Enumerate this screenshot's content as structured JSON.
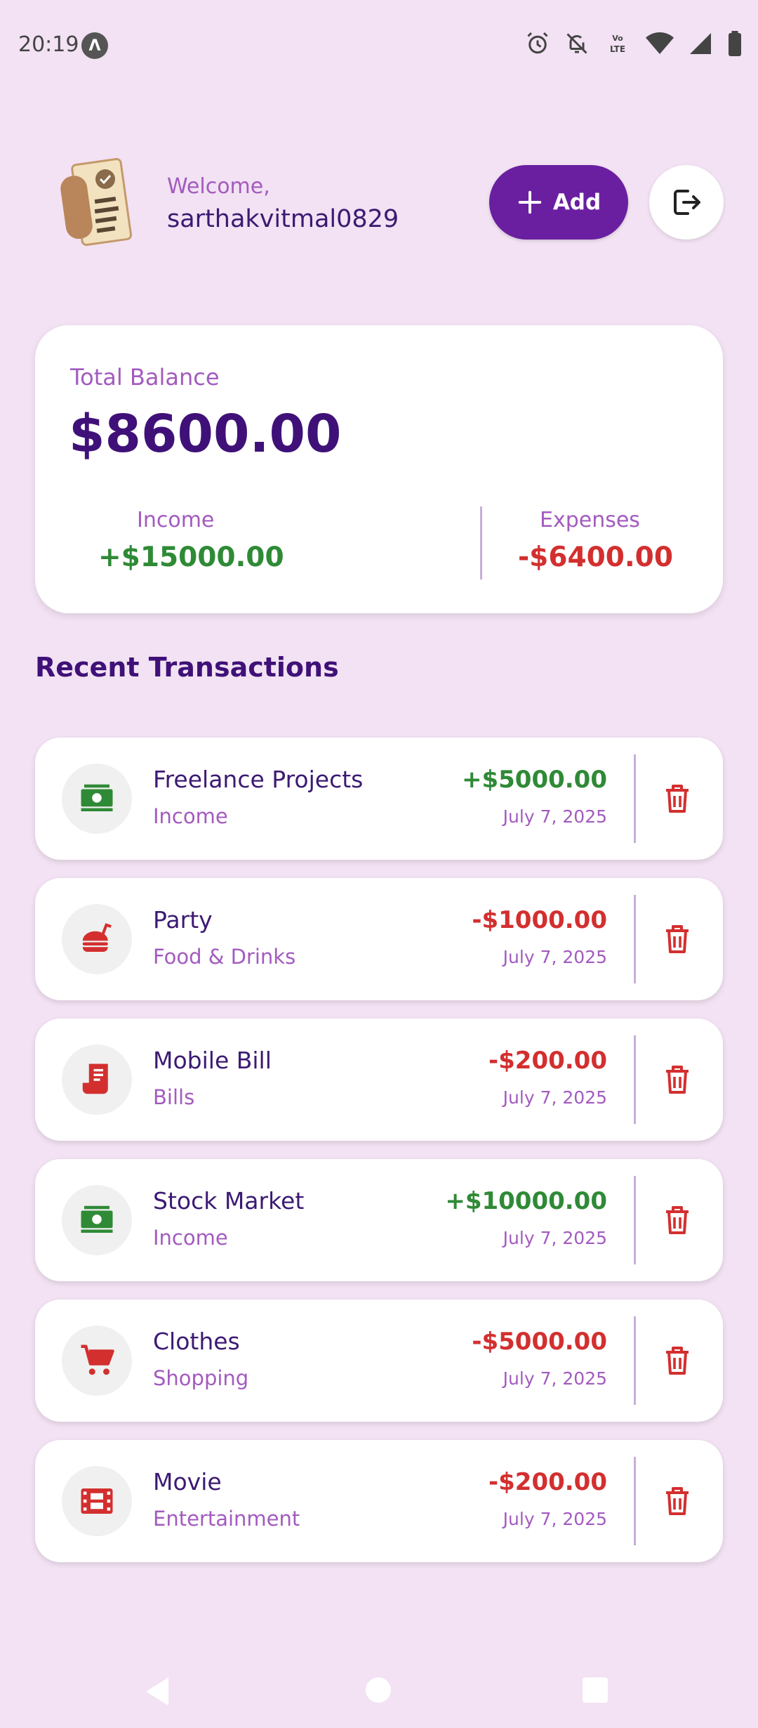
{
  "status_bar": {
    "time": "20:19",
    "app_badge": "Λ",
    "lte_label": "LTE"
  },
  "header": {
    "welcome": "Welcome,",
    "username": "sarthakvitmal0829",
    "add_label": "Add"
  },
  "balance": {
    "label": "Total Balance",
    "amount": "$8600.00",
    "income_label": "Income",
    "income_amount": "+$15000.00",
    "expenses_label": "Expenses",
    "expenses_amount": "-$6400.00"
  },
  "section_title": "Recent Transactions",
  "transactions": [
    {
      "title": "Freelance Projects",
      "category": "Income",
      "amount": "+$5000.00",
      "date": "July 7, 2025",
      "icon": "money-icon"
    },
    {
      "title": "Party",
      "category": "Food & Drinks",
      "amount": "-$1000.00",
      "date": "July 7, 2025",
      "icon": "food-icon"
    },
    {
      "title": "Mobile Bill",
      "category": "Bills",
      "amount": "-$200.00",
      "date": "July 7, 2025",
      "icon": "receipt-icon"
    },
    {
      "title": "Stock Market",
      "category": "Income",
      "amount": "+$10000.00",
      "date": "July 7, 2025",
      "icon": "money-icon"
    },
    {
      "title": "Clothes",
      "category": "Shopping",
      "amount": "-$5000.00",
      "date": "July 7, 2025",
      "icon": "cart-icon"
    },
    {
      "title": "Movie",
      "category": "Entertainment",
      "amount": "-$200.00",
      "date": "July 7, 2025",
      "icon": "film-icon"
    }
  ],
  "colors": {
    "background": "#f2e2f3",
    "primary": "#6a1fa0",
    "income": "#2f8a36",
    "expense": "#d32f2f"
  }
}
